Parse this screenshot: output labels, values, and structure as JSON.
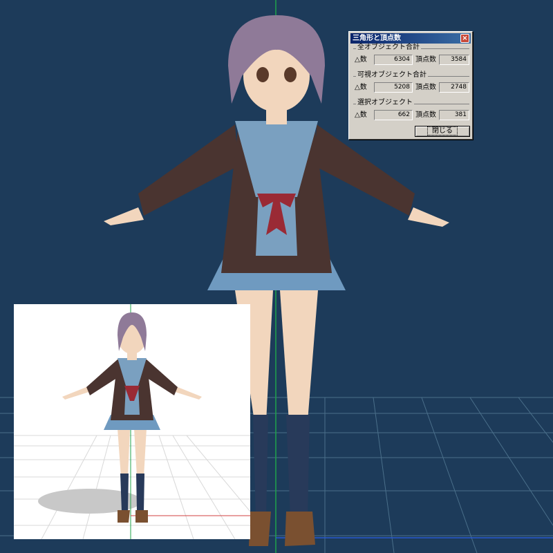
{
  "dialog": {
    "title": "三角形と頂点数",
    "close_glyph": "×",
    "groups": [
      {
        "label": "全オブジェクト合計",
        "tri_label": "△数",
        "tri_value": "6304",
        "vert_label": "頂点数",
        "vert_value": "3584"
      },
      {
        "label": "可視オブジェクト合計",
        "tri_label": "△数",
        "tri_value": "5208",
        "vert_label": "頂点数",
        "vert_value": "2748"
      },
      {
        "label": "選択オブジェクト",
        "tri_label": "△数",
        "tri_value": "662",
        "vert_label": "頂点数",
        "vert_value": "381"
      }
    ],
    "close_button": "閉じる"
  },
  "colors": {
    "viewport_bg": "#1d3b5a",
    "axis_green": "#1fa34a",
    "axis_blue": "#2a5ad0",
    "grid": "#4a6f8a",
    "jacket": "#4a3430",
    "sailor": "#7aa0c0",
    "skirt": "#6f9ac0",
    "ribbon": "#9a2a35",
    "hair": "#8f7a98",
    "skin": "#f2d6bd",
    "socks": "#283a5a",
    "shoes": "#7a5030"
  }
}
